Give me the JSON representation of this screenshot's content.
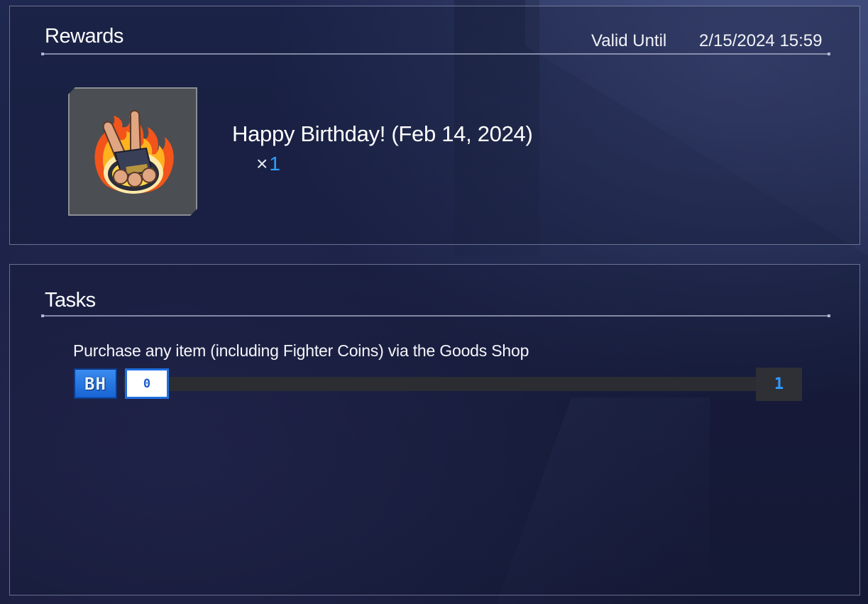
{
  "rewards": {
    "title": "Rewards",
    "valid_until_label": "Valid Until",
    "valid_until_value": "2/15/2024 15:59",
    "item": {
      "name": "Happy Birthday! (Feb 14, 2024)",
      "quantity_prefix": "×",
      "quantity": "1",
      "icon": "peace-sign-fire-icon"
    }
  },
  "tasks": {
    "title": "Tasks",
    "items": [
      {
        "description": "Purchase any item (including Fighter Coins) via the Goods Shop",
        "rank_badge": "BH",
        "current": "0",
        "target": "1",
        "progress_fraction": 0
      }
    ]
  },
  "colors": {
    "accent_blue": "#2fa0ff",
    "badge_blue": "#1f6fe0",
    "track": "#2c2d33"
  }
}
